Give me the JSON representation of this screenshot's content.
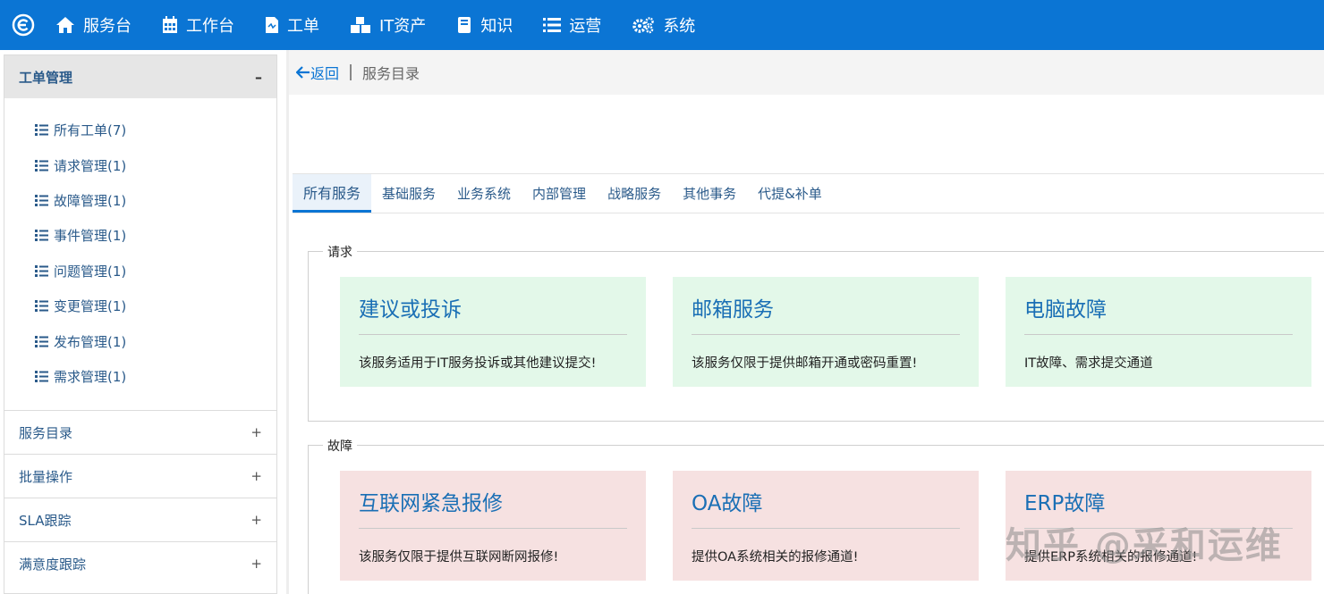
{
  "topnav": {
    "items": [
      {
        "label": "服务台",
        "icon": "home-icon"
      },
      {
        "label": "工作台",
        "icon": "calendar-icon"
      },
      {
        "label": "工单",
        "icon": "document-icon"
      },
      {
        "label": "IT资产",
        "icon": "cubes-icon"
      },
      {
        "label": "知识",
        "icon": "book-icon"
      },
      {
        "label": "运营",
        "icon": "list-icon"
      },
      {
        "label": "系统",
        "icon": "gears-icon"
      }
    ],
    "bg_color": "#0b75d4"
  },
  "sidebar": {
    "panel_title": "工单管理",
    "panel_toggle": "–",
    "items": [
      {
        "label": "所有工单(7)"
      },
      {
        "label": "请求管理(1)"
      },
      {
        "label": "故障管理(1)"
      },
      {
        "label": "事件管理(1)"
      },
      {
        "label": "问题管理(1)"
      },
      {
        "label": "变更管理(1)"
      },
      {
        "label": "发布管理(1)"
      },
      {
        "label": "需求管理(1)"
      }
    ],
    "sections": [
      {
        "label": "服务目录",
        "toggle": "+"
      },
      {
        "label": "批量操作",
        "toggle": "+"
      },
      {
        "label": "SLA跟踪",
        "toggle": "+"
      },
      {
        "label": "满意度跟踪",
        "toggle": "+"
      }
    ]
  },
  "breadcrumb": {
    "back_label": "返回",
    "current": "服务目录"
  },
  "tabs": [
    {
      "label": "所有服务",
      "active": true
    },
    {
      "label": "基础服务"
    },
    {
      "label": "业务系统"
    },
    {
      "label": "内部管理"
    },
    {
      "label": "战略服务"
    },
    {
      "label": "其他事务"
    },
    {
      "label": "代提&补单"
    }
  ],
  "groups": [
    {
      "legend": "请求",
      "color": "#e3f8e9",
      "cards": [
        {
          "title": "建议或投诉",
          "desc": "该服务适用于IT服务投诉或其他建议提交!"
        },
        {
          "title": "邮箱服务",
          "desc": "该服务仅限于提供邮箱开通或密码重置!"
        },
        {
          "title": "电脑故障",
          "desc": "IT故障、需求提交通道"
        }
      ]
    },
    {
      "legend": "故障",
      "color": "#f6e1e1",
      "cards": [
        {
          "title": "互联网紧急报修",
          "desc": "该服务仅限于提供互联网断网报修!"
        },
        {
          "title": "OA故障",
          "desc": "提供OA系统相关的报修通道!"
        },
        {
          "title": "ERP故障",
          "desc": "提供ERP系统相关的报修通道!"
        }
      ]
    }
  ],
  "watermark": "知乎 @采和运维"
}
